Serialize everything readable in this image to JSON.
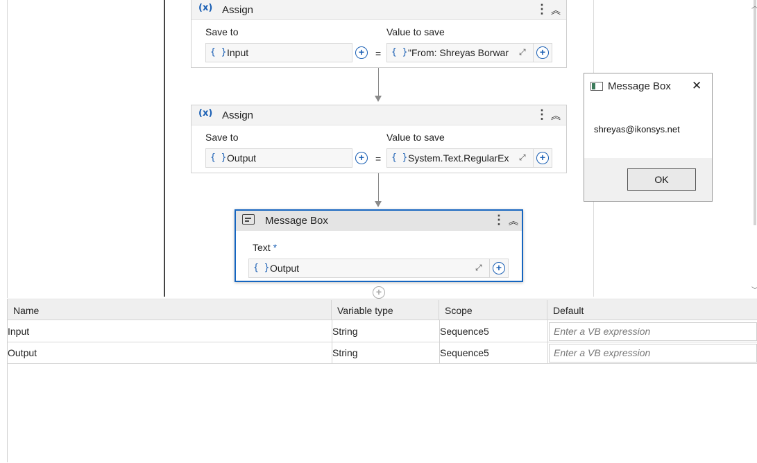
{
  "assign1": {
    "title": "Assign",
    "save_to_label": "Save to",
    "value_label": "Value to save",
    "save_to_value": "Input",
    "value_text": "\"From: Shreyas Borwar",
    "equals": "="
  },
  "assign2": {
    "title": "Assign",
    "save_to_label": "Save to",
    "value_label": "Value to save",
    "save_to_value": "Output",
    "value_text": "System.Text.RegularEx",
    "equals": "="
  },
  "message_box_activity": {
    "title": "Message Box",
    "text_label": "Text",
    "required_mark": "*",
    "text_value": "Output"
  },
  "dialog": {
    "title": "Message Box",
    "message": "shreyas@ikonsys.net",
    "ok_label": "OK"
  },
  "variables": {
    "headers": [
      "Name",
      "Variable type",
      "Scope",
      "Default"
    ],
    "rows": [
      {
        "name": "Input",
        "type": "String",
        "scope": "Sequence5",
        "default_placeholder": "Enter a VB expression"
      },
      {
        "name": "Output",
        "type": "String",
        "scope": "Sequence5",
        "default_placeholder": "Enter a VB expression"
      }
    ]
  },
  "icons": {
    "assign_icon": "(x)",
    "brace_icon": "{ }",
    "plus_icon": "+",
    "more_icon": "⋮",
    "collapse_icon": "︽",
    "expand_icon": "⤢",
    "close_icon": "✕"
  },
  "colors": {
    "accent": "#1a5fb4",
    "selected_border": "#1565c0"
  }
}
